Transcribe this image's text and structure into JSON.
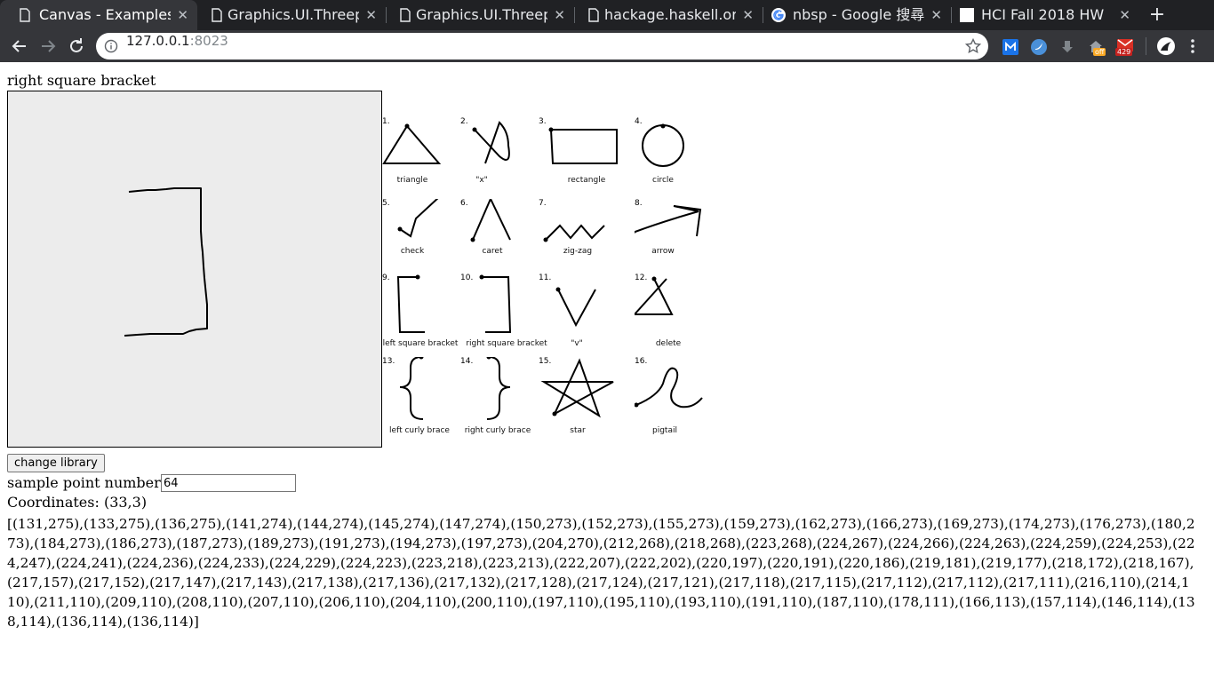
{
  "browser": {
    "tabs": [
      {
        "title": "Canvas - Examples",
        "icon": "document-icon",
        "active": true
      },
      {
        "title": "Graphics.UI.Threep",
        "icon": "document-icon",
        "active": false
      },
      {
        "title": "Graphics.UI.Threep",
        "icon": "document-icon",
        "active": false
      },
      {
        "title": "hackage.haskell.or",
        "icon": "document-icon",
        "active": false
      },
      {
        "title": "nbsp - Google 搜尋",
        "icon": "google-icon",
        "active": false
      },
      {
        "title": "HCI Fall 2018    HW",
        "icon": "white-square-icon",
        "active": false
      }
    ],
    "close_glyph": "✕",
    "new_tab_glyph": "+",
    "url_host": "127.0.0.1",
    "url_port": ":8023",
    "extensions": {
      "off_badge": "off",
      "mail_badge": "429"
    }
  },
  "page": {
    "gesture_label": "right square bracket",
    "change_button": "change library",
    "sample_label": "sample point number:",
    "sample_value": "64",
    "coordinates_label": "Coordinates: (33,3)",
    "coordinates_list": "[(131,275),(133,275),(136,275),(141,274),(144,274),(145,274),(147,274),(150,273),(152,273),(155,273),(159,273),(162,273),(166,273),(169,273),(174,273),(176,273),(180,273),(184,273),(186,273),(187,273),(189,273),(191,273),(194,273),(197,273),(204,270),(212,268),(218,268),(223,268),(224,267),(224,266),(224,263),(224,259),(224,253),(224,247),(224,241),(224,236),(224,233),(224,229),(224,223),(223,218),(223,213),(222,207),(222,202),(220,197),(220,191),(220,186),(219,181),(219,177),(218,172),(218,167),(217,157),(217,152),(217,147),(217,143),(217,138),(217,136),(217,132),(217,128),(217,124),(217,121),(217,118),(217,115),(217,112),(217,112),(217,111),(216,110),(214,110),(211,110),(209,110),(208,110),(207,110),(206,110),(204,110),(200,110),(197,110),(195,110),(193,110),(191,110),(187,110),(178,111),(166,113),(157,114),(146,114),(138,114),(136,114),(136,114)]"
  },
  "library": [
    {
      "num": "1.",
      "name": "triangle"
    },
    {
      "num": "2.",
      "name": "\"x\""
    },
    {
      "num": "3.",
      "name": "rectangle"
    },
    {
      "num": "4.",
      "name": "circle"
    },
    {
      "num": "5.",
      "name": "check"
    },
    {
      "num": "6.",
      "name": "caret"
    },
    {
      "num": "7.",
      "name": "zig-zag"
    },
    {
      "num": "8.",
      "name": "arrow"
    },
    {
      "num": "9.",
      "name": "left square bracket"
    },
    {
      "num": "10.",
      "name": "right square bracket"
    },
    {
      "num": "11.",
      "name": "\"v\""
    },
    {
      "num": "12.",
      "name": "delete"
    },
    {
      "num": "13.",
      "name": "left curly brace"
    },
    {
      "num": "14.",
      "name": "right curly brace"
    },
    {
      "num": "15.",
      "name": "star"
    },
    {
      "num": "16.",
      "name": "pigtail"
    }
  ]
}
